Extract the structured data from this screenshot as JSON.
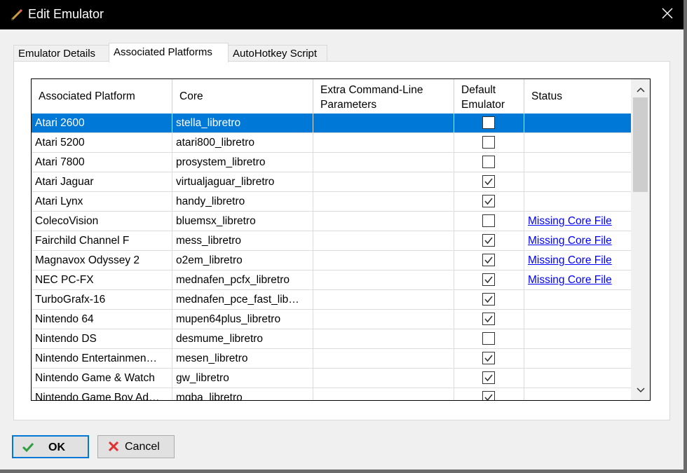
{
  "window": {
    "title": "Edit Emulator",
    "icon": "pencil-icon"
  },
  "tabs": [
    {
      "label": "Emulator Details",
      "active": false
    },
    {
      "label": "Associated Platforms",
      "active": true
    },
    {
      "label": "AutoHotkey Script",
      "active": false
    }
  ],
  "grid": {
    "columns": [
      "Associated Platform",
      "Core",
      "Extra Command-Line Parameters",
      "Default Emulator",
      "Status"
    ],
    "rows": [
      {
        "platform": "Atari 2600",
        "core": "stella_libretro",
        "params": "",
        "default": false,
        "status": "",
        "selected": true
      },
      {
        "platform": "Atari 5200",
        "core": "atari800_libretro",
        "params": "",
        "default": false,
        "status": ""
      },
      {
        "platform": "Atari 7800",
        "core": "prosystem_libretro",
        "params": "",
        "default": false,
        "status": ""
      },
      {
        "platform": "Atari Jaguar",
        "core": "virtualjaguar_libretro",
        "params": "",
        "default": true,
        "status": ""
      },
      {
        "platform": "Atari Lynx",
        "core": "handy_libretro",
        "params": "",
        "default": true,
        "status": ""
      },
      {
        "platform": "ColecoVision",
        "core": "bluemsx_libretro",
        "params": "",
        "default": false,
        "status": "Missing Core File"
      },
      {
        "platform": "Fairchild Channel F",
        "core": "mess_libretro",
        "params": "",
        "default": true,
        "status": "Missing Core File"
      },
      {
        "platform": "Magnavox Odyssey 2",
        "core": "o2em_libretro",
        "params": "",
        "default": true,
        "status": "Missing Core File"
      },
      {
        "platform": "NEC PC-FX",
        "core": "mednafen_pcfx_libretro",
        "params": "",
        "default": true,
        "status": "Missing Core File"
      },
      {
        "platform": "TurboGrafx-16",
        "core": "mednafen_pce_fast_lib…",
        "params": "",
        "default": true,
        "status": ""
      },
      {
        "platform": "Nintendo 64",
        "core": "mupen64plus_libretro",
        "params": "",
        "default": true,
        "status": ""
      },
      {
        "platform": "Nintendo DS",
        "core": "desmume_libretro",
        "params": "",
        "default": false,
        "status": ""
      },
      {
        "platform": "Nintendo Entertainmen…",
        "core": "mesen_libretro",
        "params": "",
        "default": true,
        "status": ""
      },
      {
        "platform": "Nintendo Game & Watch",
        "core": "gw_libretro",
        "params": "",
        "default": true,
        "status": ""
      },
      {
        "platform": "Nintendo Game Boy Ad…",
        "core": "mgba_libretro",
        "params": "",
        "default": true,
        "status": ""
      }
    ]
  },
  "buttons": {
    "ok": {
      "label": "OK",
      "icon": "checkmark-icon"
    },
    "cancel": {
      "label": "Cancel",
      "icon": "x-icon"
    }
  },
  "colors": {
    "selection": "#0078d7",
    "link": "#0000ff",
    "ok_check": "#2e9e3e",
    "cancel_x": "#e03030"
  }
}
